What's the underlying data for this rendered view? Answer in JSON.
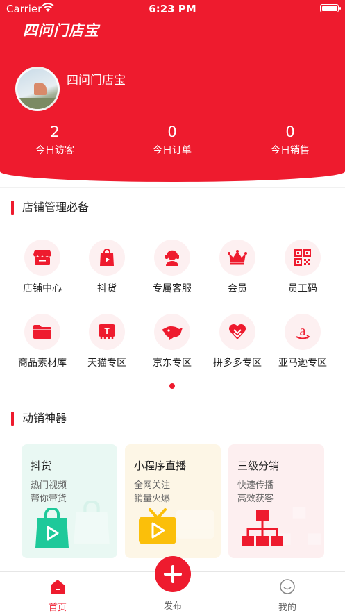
{
  "status": {
    "carrier": "Carrier",
    "time": "6:23 PM"
  },
  "app": {
    "title": "四问门店宝"
  },
  "profile": {
    "shop_name": "四问门店宝"
  },
  "stats": [
    {
      "value": "2",
      "label": "今日访客"
    },
    {
      "value": "0",
      "label": "今日订单"
    },
    {
      "value": "0",
      "label": "今日销售"
    }
  ],
  "shop_section": {
    "title": "店铺管理必备"
  },
  "shop_items": [
    {
      "label": "店铺中心",
      "icon": "store-icon"
    },
    {
      "label": "抖货",
      "icon": "shopping-bag-play-icon"
    },
    {
      "label": "专属客服",
      "icon": "customer-service-icon"
    },
    {
      "label": "会员",
      "icon": "crown-icon"
    },
    {
      "label": "员工码",
      "icon": "qr-code-icon"
    },
    {
      "label": "商品素材库",
      "icon": "folder-icon"
    },
    {
      "label": "天猫专区",
      "icon": "tmall-icon"
    },
    {
      "label": "京东专区",
      "icon": "jd-dog-icon"
    },
    {
      "label": "拼多多专区",
      "icon": "pinduoduo-icon"
    },
    {
      "label": "亚马逊专区",
      "icon": "amazon-icon"
    }
  ],
  "promo_section": {
    "title": "动销神器"
  },
  "promo_cards": [
    {
      "title": "抖货",
      "line1": "热门视频",
      "line2": "帮你带货",
      "bg": "#e9f8f3",
      "icon": "video-bag-icon"
    },
    {
      "title": "小程序直播",
      "line1": "全网关注",
      "line2": "销量火爆",
      "bg": "#fdf6e6",
      "icon": "tv-icon"
    },
    {
      "title": "三级分销",
      "line1": "快速传播",
      "line2": "高效获客",
      "bg": "#fdeff0",
      "icon": "hierarchy-icon"
    }
  ],
  "tabbar": {
    "home": "首页",
    "publish": "发布",
    "mine": "我的"
  },
  "colors": {
    "accent": "#ee1b2e",
    "teal": "#1ec99a",
    "amber": "#fbbf0a"
  }
}
